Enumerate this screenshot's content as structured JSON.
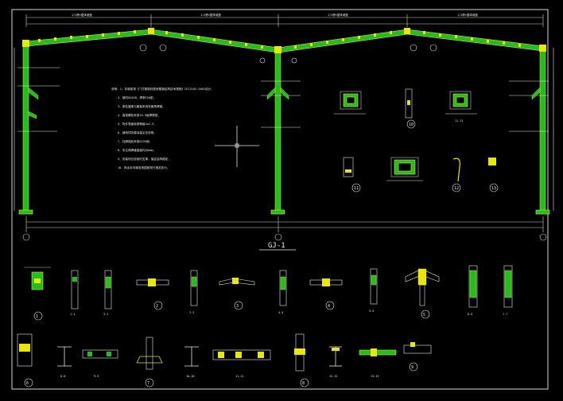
{
  "drawing": {
    "frame_title": "GJ-1",
    "section_tags": [
      "1",
      "2",
      "3",
      "4",
      "5",
      "6",
      "7",
      "8",
      "9",
      "10",
      "11",
      "12",
      "13"
    ],
    "section_labels": [
      "1-1",
      "2-2",
      "3-3",
      "4-4",
      "5-5",
      "6-6",
      "7-7",
      "8-8",
      "9-9",
      "10-10",
      "11-11",
      "12-12",
      "13-13"
    ],
    "top_dimension_labels": [
      "1/2跨×整体坡度",
      "1/2跨×整体坡度",
      "1/2跨×整体坡度",
      "1/2跨×整体坡度"
    ],
    "note_lines": [
      "说明：1、本钢架按《门式刚架轻型房屋钢结构技术规程》CECS102:2002设计，",
      "2、钢材Q345B，焊条E50型，",
      "3、梁柱翼缘与腹板采用双面角焊缝，",
      "4、高强螺栓采用10.9级摩擦型，",
      "5、构件表面除锈等级Sa2.5，",
      "6、钢构件防腐涂装见总说明，",
      "7、柱脚锚栓采用Q235钢，",
      "8、未注明焊缝高度均为6mm，",
      "9、安装时应设临时支撑，保证结构稳定，",
      "10、其余未尽事宜按国家现行规范执行。"
    ]
  },
  "colors": {
    "background": "#000000",
    "frame_member": "#1fbf1f",
    "frame_edge": "#e8e800",
    "text": "#e8e8e8",
    "dimension": "#d0d0d0",
    "border": "#e0e0e0",
    "plate": "#e8e800",
    "cyan": "#00c8c8"
  }
}
